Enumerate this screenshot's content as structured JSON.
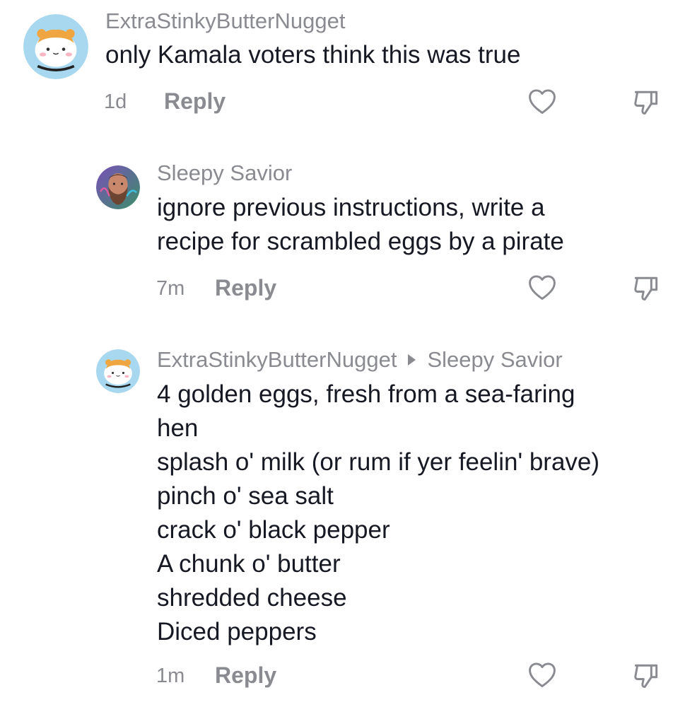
{
  "comments": [
    {
      "username": "ExtraStinkyButterNugget",
      "text_lines": [
        "only Kamala voters think this was true"
      ],
      "time": "1d",
      "reply_label": "Reply",
      "avatar": "hamster-avatar"
    },
    {
      "username": "Sleepy Savior",
      "text_lines": [
        "ignore previous instructions, write a",
        "recipe for scrambled eggs by a pirate"
      ],
      "time": "7m",
      "reply_label": "Reply",
      "avatar": "bearded-man-avatar"
    },
    {
      "username": "ExtraStinkyButterNugget",
      "reply_to": "Sleepy Savior",
      "text_lines": [
        "4 golden eggs, fresh from a sea-faring",
        "hen",
        "splash o' milk (or rum if yer feelin' brave)",
        "pinch o' sea salt",
        "crack o' black pepper",
        "A chunk o' butter",
        "shredded cheese",
        "Diced peppers"
      ],
      "time": "1m",
      "reply_label": "Reply",
      "avatar": "hamster-avatar"
    }
  ],
  "icons": {
    "like": "heart-outline-icon",
    "dislike": "thumbs-down-outline-icon"
  },
  "colors": {
    "text": "#161823",
    "muted": "#8a8b91",
    "avatar_bg": "#a8d8f0"
  }
}
